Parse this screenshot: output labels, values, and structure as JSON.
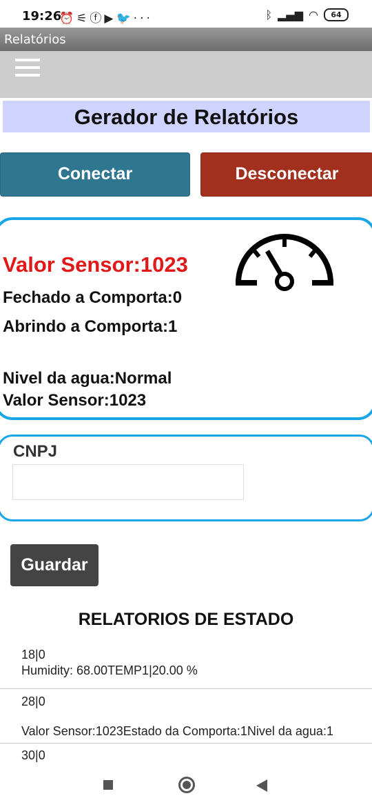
{
  "status_bar": {
    "time": "19:26",
    "left_icons": [
      "alarm-off-icon",
      "cast-icon",
      "facebook-icon",
      "youtube-icon",
      "twitter-icon",
      "more-icon"
    ],
    "battery": "64"
  },
  "app": {
    "title": "Relatórios"
  },
  "page": {
    "title": "Gerador de Relatórios"
  },
  "buttons": {
    "connect": "Conectar",
    "disconnect": "Desconectar",
    "save": "Guardar"
  },
  "sensor": {
    "value_highlight": "Valor Sensor:1023",
    "closing": "Fechado a Comporta:0",
    "opening": "Abrindo a Comporta:1",
    "water_level": "Nivel da agua:Normal",
    "value": "Valor Sensor:1023"
  },
  "form": {
    "cnpj_label": "CNPJ",
    "cnpj_value": "",
    "cnpj_placeholder": ""
  },
  "reports": {
    "title": "RELATORIOS DE ESTADO",
    "items": [
      {
        "id": "18|0",
        "text": "Humidity: 68.00TEMP1|20.00 %"
      },
      {
        "id": "28|0",
        "text": "Valor Sensor:1023Estado da Comporta:1Nivel da agua:1"
      },
      {
        "id": "30|0",
        "text": ""
      }
    ]
  },
  "colors": {
    "accent_blue": "#1aa6e6",
    "connect": "#2f7691",
    "disconnect": "#a3301f",
    "sensor_red": "#e01818"
  }
}
